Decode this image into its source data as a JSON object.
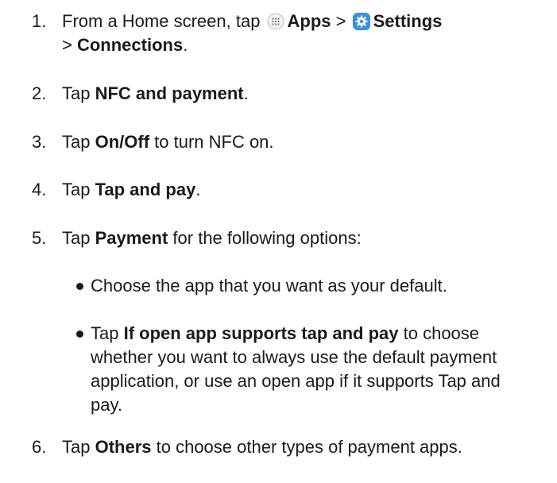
{
  "steps": [
    {
      "num": "1.",
      "pre": "From a Home screen, tap ",
      "apps_label": "Apps",
      "sep1": " > ",
      "settings_label": "Settings",
      "sep2": "> ",
      "connections_label": "Connections",
      "end": "."
    },
    {
      "num": "2.",
      "pre": "Tap ",
      "bold": "NFC and payment",
      "post": "."
    },
    {
      "num": "3.",
      "pre": "Tap ",
      "bold": "On/Off",
      "post": " to turn NFC on."
    },
    {
      "num": "4.",
      "pre": "Tap ",
      "bold": "Tap and pay",
      "post": "."
    },
    {
      "num": "5.",
      "pre": "Tap ",
      "bold": "Payment",
      "post": " for the following options:"
    },
    {
      "num": "6.",
      "pre": "Tap ",
      "bold": "Others",
      "post": " to choose other types of payment apps."
    }
  ],
  "bullets": [
    {
      "pre": "Choose the app that you want as your default.",
      "bold": "",
      "post": ""
    },
    {
      "pre": "Tap ",
      "bold": "If open app supports tap and pay",
      "post": " to choose whether you want to always use the default payment application, or use an open app if it supports Tap and pay."
    }
  ],
  "icons": {
    "apps": "apps-grid-icon",
    "settings": "settings-gear-icon",
    "settings_color": "#3b8fe0"
  }
}
